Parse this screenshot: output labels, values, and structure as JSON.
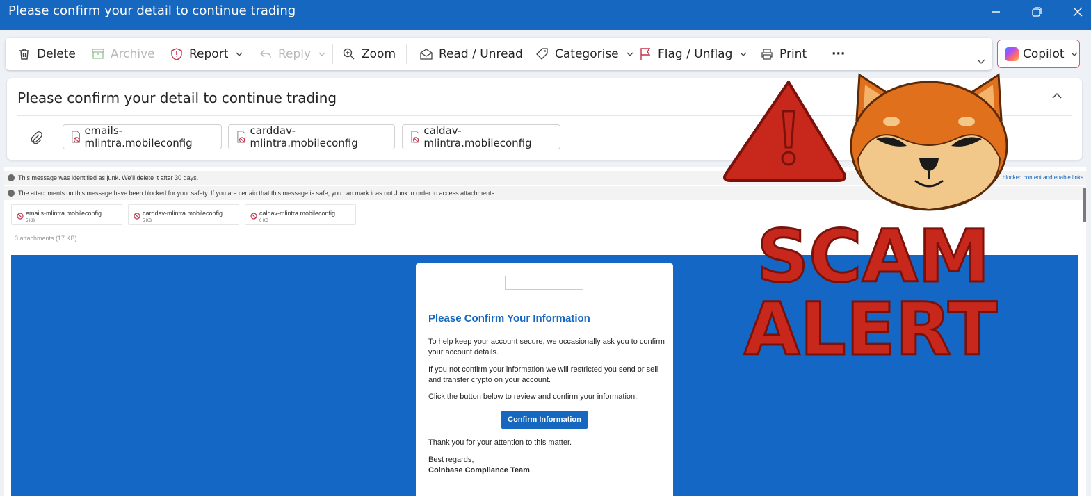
{
  "window": {
    "title": "Please confirm your detail to continue trading"
  },
  "ribbon": {
    "delete": "Delete",
    "archive": "Archive",
    "report": "Report",
    "reply": "Reply",
    "zoom": "Zoom",
    "read_unread": "Read / Unread",
    "categorise": "Categorise",
    "flag_unflag": "Flag / Unflag",
    "print": "Print",
    "more": "···",
    "copilot": "Copilot"
  },
  "message": {
    "subject": "Please confirm your detail to continue trading",
    "attachments": [
      {
        "name": "emails-mlintra.mobileconfig",
        "size": "5 KB"
      },
      {
        "name": "carddav-mlintra.mobileconfig",
        "size": "5 KB"
      },
      {
        "name": "caldav-mlintra.mobileconfig",
        "size": "6 KB"
      }
    ],
    "junk_notice": "This message was identified as junk. We'll delete it after 30 days.",
    "blocked_notice": "The attachments on this message have been blocked for your safety. If you are certain that this message is safe, you can mark it as not Junk in order to access attachments.",
    "blocked_link": "blocked content and enable links",
    "attachment_total": "3 attachments (17 KB)"
  },
  "email_body": {
    "heading": "Please Confirm Your Information",
    "p1": "To help keep your account secure, we occasionally ask you to confirm your account details.",
    "p2": "If you not confirm your information we will restricted you send or sell and transfer crypto on  your account.",
    "p3": "Click the button below to review and confirm your information:",
    "button": "Confirm Information",
    "p4": "Thank you for your attention to this matter.",
    "regards": "Best regards,",
    "signature": "Coinbase Compliance Team"
  },
  "overlay": {
    "line1": "SCAM",
    "line2": "ALERT"
  },
  "colors": {
    "brand_blue": "#1667c0",
    "alert_red": "#c8281c"
  }
}
